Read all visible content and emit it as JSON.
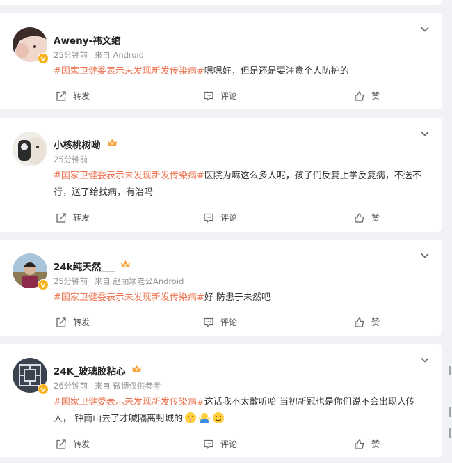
{
  "topic_tag": "#国家卫健委表示未发现新发传染病#",
  "actions": {
    "share": "转发",
    "comment": "评论",
    "like": "赞"
  },
  "posts": [
    {
      "username": "Aweny-祎文绾",
      "time": "25分钟前",
      "source": "来自 Android",
      "text": "嗯嗯好，但是还是要注意个人防护的"
    },
    {
      "username": "小核桃树呦",
      "time": "25分钟前",
      "source": "",
      "text": "医院为嘛这么多人呢，孩子们反复上学反复病，不送不行，送了给找病，有治吗"
    },
    {
      "username": "24k纯天然___",
      "time": "25分钟前",
      "source": "来自 赵丽颖老公Android",
      "text": "好 防患于未然吧"
    },
    {
      "username": "24K_玻璃胶粘心",
      "time": "26分钟前",
      "source": "来自 微博仅供参考",
      "text": "这话我不太敢听哈 当初新冠也是你们说不会出现人传人， 钟南山去了才喊隔离封城的"
    }
  ],
  "emojis": [
    "hush-emoji",
    "shrug-emoji",
    "grimace-emoji"
  ]
}
